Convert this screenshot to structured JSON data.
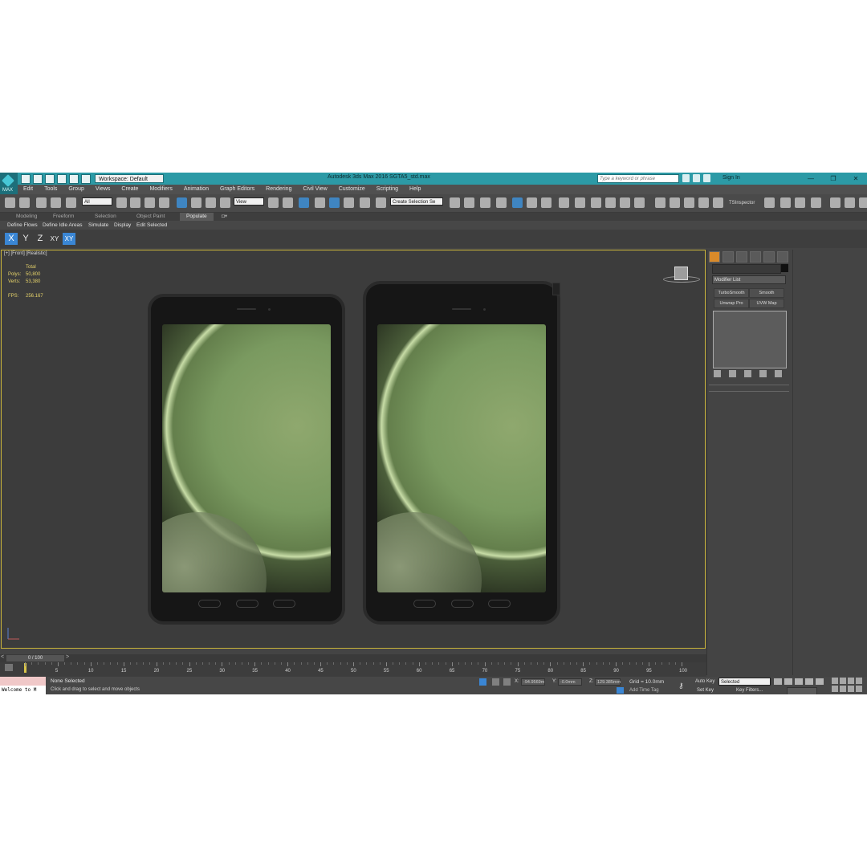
{
  "title": {
    "workspace": "Workspace: Default",
    "window_title": "Autodesk 3ds Max 2016    SGTA5_std.max",
    "search_placeholder": "Type a keyword or phrase",
    "sign_in": "Sign In",
    "logo_label": "MAX"
  },
  "menu": [
    "Edit",
    "Tools",
    "Group",
    "Views",
    "Create",
    "Modifiers",
    "Animation",
    "Graph Editors",
    "Rendering",
    "Civil View",
    "Customize",
    "Scripting",
    "Help"
  ],
  "toolbar": {
    "filter_all": "All",
    "ref_coord": "View",
    "selection_set": "Create Selection Se",
    "ts_inspector": "TSInspector"
  },
  "ribbon": {
    "tabs": [
      "Modeling",
      "Freeform",
      "Selection",
      "Object Paint",
      "Populate"
    ],
    "active_tab": "Populate",
    "subtools": [
      "Define Flows",
      "Define Idle Areas",
      "Simulate",
      "Display",
      "Edit Selected"
    ]
  },
  "axis": {
    "buttons": [
      "X",
      "Y",
      "Z",
      "XY",
      "XY"
    ],
    "selected": [
      "X",
      "XY"
    ]
  },
  "viewport": {
    "label": "[+] [Front] [Realistic]",
    "stats": {
      "total_label": "Total",
      "polys_label": "Polys:",
      "polys_value": "50,800",
      "verts_label": "Verts:",
      "verts_value": "53,380",
      "fps_label": "FPS:",
      "fps_value": "256.167"
    }
  },
  "command_panel": {
    "modifier_list": "Modifier List",
    "modifiers": [
      "TurboSmooth",
      "Smooth",
      "Unwrap Pro",
      "UVW Map"
    ]
  },
  "timeline": {
    "position": "0 / 100",
    "ticks": [
      "5",
      "10",
      "15",
      "20",
      "25",
      "30",
      "35",
      "40",
      "45",
      "50",
      "55",
      "60",
      "65",
      "70",
      "75",
      "80",
      "85",
      "90",
      "95",
      "100"
    ]
  },
  "status": {
    "welcome": "Welcome to M",
    "none_selected": "None Selected",
    "prompt": "Click and drag to select and move objects",
    "x_label": "X:",
    "x_value": "-94.9569m",
    "y_label": "Y:",
    "y_value": "-0.0mm",
    "z_label": "Z:",
    "z_value": "129.385mm",
    "grid": "Grid = 10.0mm",
    "add_time_tag": "Add Time Tag",
    "auto_key": "Auto Key",
    "set_key": "Set Key",
    "selected": "Selected",
    "key_filters": "Key Filters..."
  },
  "colors": {
    "titlebar": "#2c9aa6",
    "viewport_border": "#c9b33a",
    "stat_text": "#e6d36a",
    "accent_blue": "#3a86d4",
    "command_tab_active": "#d98a2a",
    "phone_wallpaper": "#7a9a60"
  }
}
